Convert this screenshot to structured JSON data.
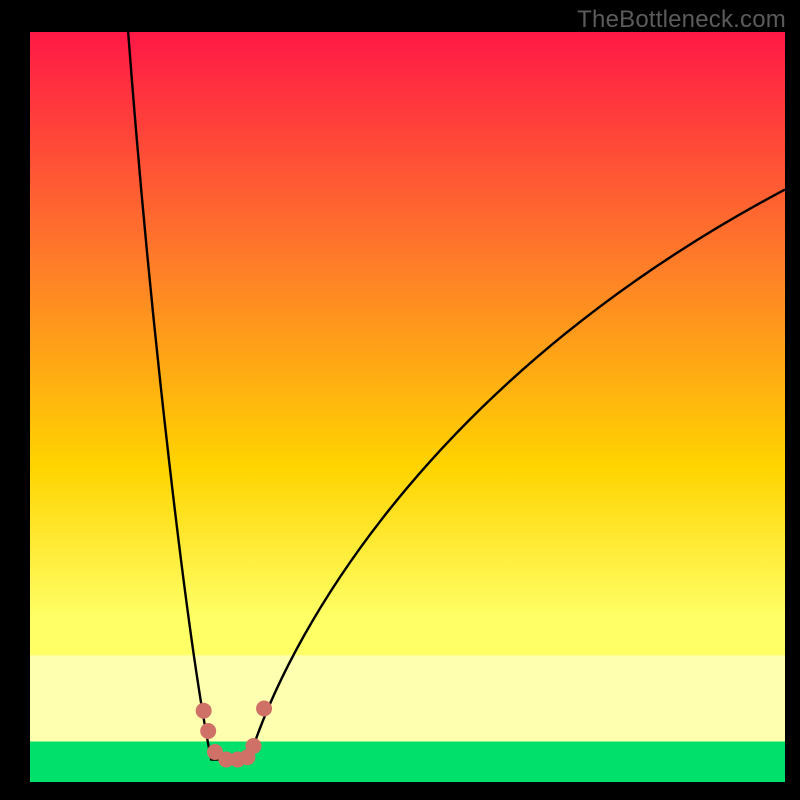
{
  "watermark": "TheBottleneck.com",
  "colors": {
    "frame": "#000000",
    "gradient_top": "#ff1846",
    "gradient_mid1": "#ff7a2a",
    "gradient_mid2": "#ffd400",
    "gradient_mid3": "#ffff66",
    "gradient_band_pale": "#ffffb0",
    "gradient_bottom": "#00e06a",
    "curve_stroke": "#000000",
    "marker_fill": "#cf7166"
  },
  "chart_data": {
    "type": "line",
    "title": "",
    "xlabel": "",
    "ylabel": "",
    "xlim": [
      0,
      100
    ],
    "ylim": [
      0,
      100
    ],
    "curve": {
      "left_start": {
        "x": 13,
        "y": 100
      },
      "trough_start": {
        "x": 24,
        "y": 3
      },
      "trough_end": {
        "x": 29,
        "y": 3
      },
      "right_end": {
        "x": 100,
        "y": 79
      }
    },
    "markers": [
      {
        "x": 23.0,
        "y": 9.5
      },
      {
        "x": 23.6,
        "y": 6.8
      },
      {
        "x": 24.5,
        "y": 4.0
      },
      {
        "x": 26.0,
        "y": 3.0
      },
      {
        "x": 27.5,
        "y": 3.0
      },
      {
        "x": 28.8,
        "y": 3.3
      },
      {
        "x": 29.6,
        "y": 4.8
      },
      {
        "x": 31.0,
        "y": 9.8
      }
    ],
    "marker_radius_px": 8,
    "green_band_top_y": 5.5,
    "pale_band_top_y": 17
  }
}
